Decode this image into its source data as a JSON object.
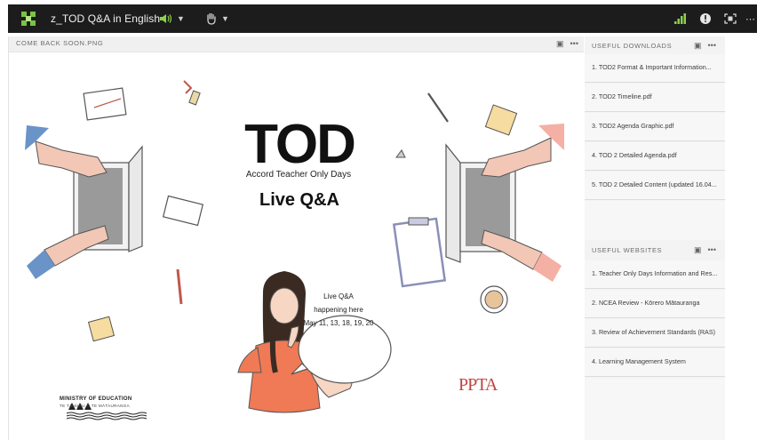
{
  "topbar": {
    "title": "z_TOD Q&A in English",
    "icons": [
      "app-grid-icon",
      "speaker-icon",
      "raise-hand-icon",
      "signal-icon",
      "alert-icon",
      "fullscreen-icon",
      "more-icon"
    ]
  },
  "main_pod": {
    "title": "COME BACK SOON.PNG",
    "content": {
      "heading": "TOD",
      "subtitle": "Accord Teacher Only Days",
      "live": "Live Q&A",
      "bubble": [
        "Live Q&A",
        "happening here",
        "May 11, 13, 18, 19, 20"
      ],
      "ministry_line1": "MINISTRY OF EDUCATION",
      "ministry_line2": "TE TĀHUHU O TE MĀTAURANGA",
      "ppta_logo": "PPTA"
    }
  },
  "downloads": {
    "title": "USEFUL DOWNLOADS",
    "items": [
      "1. TOD2 Format & Important Information...",
      "2. TOD2 Timeline.pdf",
      "3. TOD2 Agenda Graphic.pdf",
      "4. TOD 2 Detailed Agenda.pdf",
      "5. TOD 2 Detailed Content (updated 16.04..."
    ]
  },
  "websites": {
    "title": "USEFUL WEBSITES",
    "items": [
      "1. Teacher Only Days Information and Res...",
      "2. NCEA Review - Kōrero Mātauranga",
      "3. Review of Achievement Standards (RAS)",
      "4. Learning Management System"
    ]
  },
  "colors": {
    "topbar_bg": "#1c1c1c",
    "accent_green": "#8bd14a",
    "panel_bg": "#f3f3f3",
    "ppta_red": "#c2433d"
  }
}
